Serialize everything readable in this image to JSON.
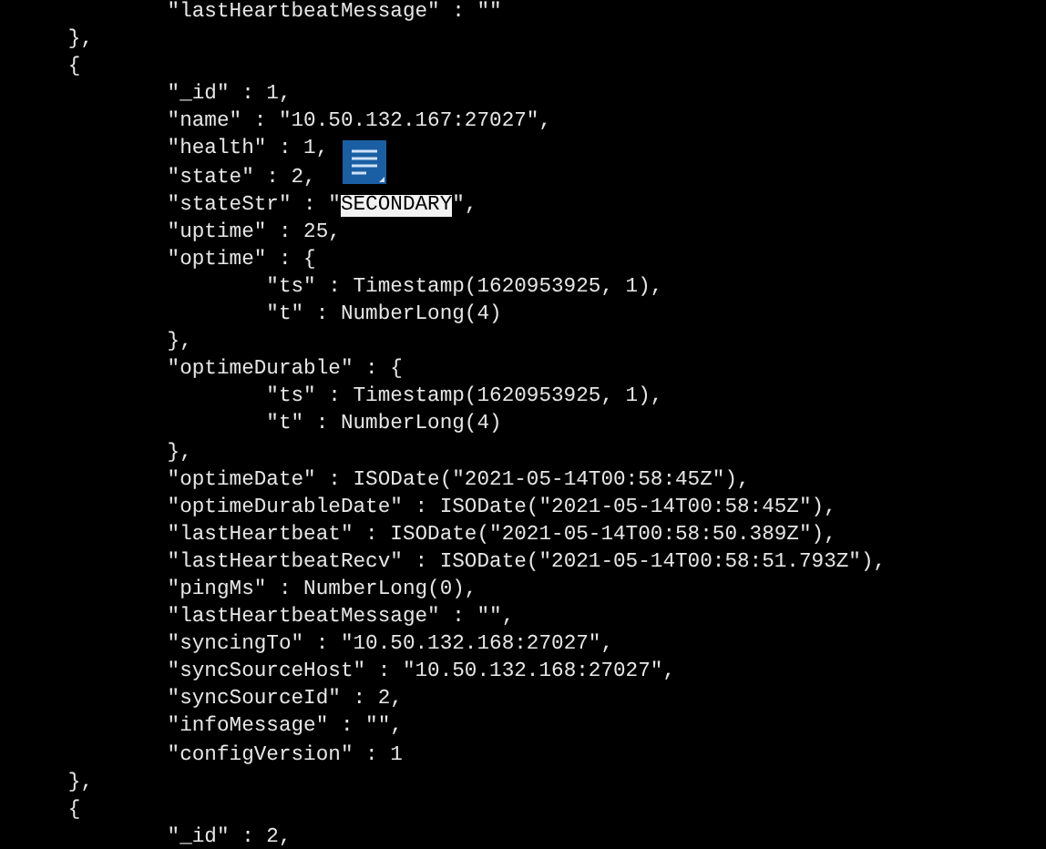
{
  "terminal": {
    "lines": [
      {
        "segments": [
          {
            "text": "\t\t\"lastHeartbeatMessage\" : \"\"",
            "selected": false
          }
        ]
      },
      {
        "segments": [
          {
            "text": "\t},",
            "selected": false
          }
        ]
      },
      {
        "segments": [
          {
            "text": "\t{",
            "selected": false
          }
        ]
      },
      {
        "segments": [
          {
            "text": "\t\t\"_id\" : 1,",
            "selected": false
          }
        ]
      },
      {
        "segments": [
          {
            "text": "\t\t\"name\" : \"10.50.132.167:27027\",",
            "selected": false
          }
        ]
      },
      {
        "segments": [
          {
            "text": "\t\t\"health\" : 1,",
            "selected": false
          }
        ]
      },
      {
        "segments": [
          {
            "text": "\t\t\"state\" : 2,",
            "selected": false
          }
        ]
      },
      {
        "segments": [
          {
            "text": "\t\t\"stateStr\" : \"",
            "selected": false
          },
          {
            "text": "SECONDARY",
            "selected": true
          },
          {
            "text": "\",",
            "selected": false
          }
        ]
      },
      {
        "segments": [
          {
            "text": "\t\t\"uptime\" : 25,",
            "selected": false
          }
        ]
      },
      {
        "segments": [
          {
            "text": "\t\t\"optime\" : {",
            "selected": false
          }
        ]
      },
      {
        "segments": [
          {
            "text": "\t\t\t\"ts\" : Timestamp(1620953925, 1),",
            "selected": false
          }
        ]
      },
      {
        "segments": [
          {
            "text": "\t\t\t\"t\" : NumberLong(4)",
            "selected": false
          }
        ]
      },
      {
        "segments": [
          {
            "text": "\t\t},",
            "selected": false
          }
        ]
      },
      {
        "segments": [
          {
            "text": "\t\t\"optimeDurable\" : {",
            "selected": false
          }
        ]
      },
      {
        "segments": [
          {
            "text": "\t\t\t\"ts\" : Timestamp(1620953925, 1),",
            "selected": false
          }
        ]
      },
      {
        "segments": [
          {
            "text": "\t\t\t\"t\" : NumberLong(4)",
            "selected": false
          }
        ]
      },
      {
        "segments": [
          {
            "text": "\t\t},",
            "selected": false
          }
        ]
      },
      {
        "segments": [
          {
            "text": "\t\t\"optimeDate\" : ISODate(\"2021-05-14T00:58:45Z\"),",
            "selected": false
          }
        ]
      },
      {
        "segments": [
          {
            "text": "\t\t\"optimeDurableDate\" : ISODate(\"2021-05-14T00:58:45Z\"),",
            "selected": false
          }
        ]
      },
      {
        "segments": [
          {
            "text": "\t\t\"lastHeartbeat\" : ISODate(\"2021-05-14T00:58:50.389Z\"),",
            "selected": false
          }
        ]
      },
      {
        "segments": [
          {
            "text": "\t\t\"lastHeartbeatRecv\" : ISODate(\"2021-05-14T00:58:51.793Z\"),",
            "selected": false
          }
        ]
      },
      {
        "segments": [
          {
            "text": "\t\t\"pingMs\" : NumberLong(0),",
            "selected": false
          }
        ]
      },
      {
        "segments": [
          {
            "text": "\t\t\"lastHeartbeatMessage\" : \"\",",
            "selected": false
          }
        ]
      },
      {
        "segments": [
          {
            "text": "\t\t\"syncingTo\" : \"10.50.132.168:27027\",",
            "selected": false
          }
        ]
      },
      {
        "segments": [
          {
            "text": "\t\t\"syncSourceHost\" : \"10.50.132.168:27027\",",
            "selected": false
          }
        ]
      },
      {
        "segments": [
          {
            "text": "\t\t\"syncSourceId\" : 2,",
            "selected": false
          }
        ]
      },
      {
        "segments": [
          {
            "text": "\t\t\"infoMessage\" : \"\",",
            "selected": false
          }
        ]
      },
      {
        "segments": [
          {
            "text": "\t\t\"configVersion\" : 1",
            "selected": false
          }
        ]
      },
      {
        "segments": [
          {
            "text": "\t},",
            "selected": false
          }
        ]
      },
      {
        "segments": [
          {
            "text": "\t{",
            "selected": false
          }
        ]
      },
      {
        "segments": [
          {
            "text": "\t\t\"_id\" : 2,",
            "selected": false
          }
        ]
      }
    ]
  }
}
